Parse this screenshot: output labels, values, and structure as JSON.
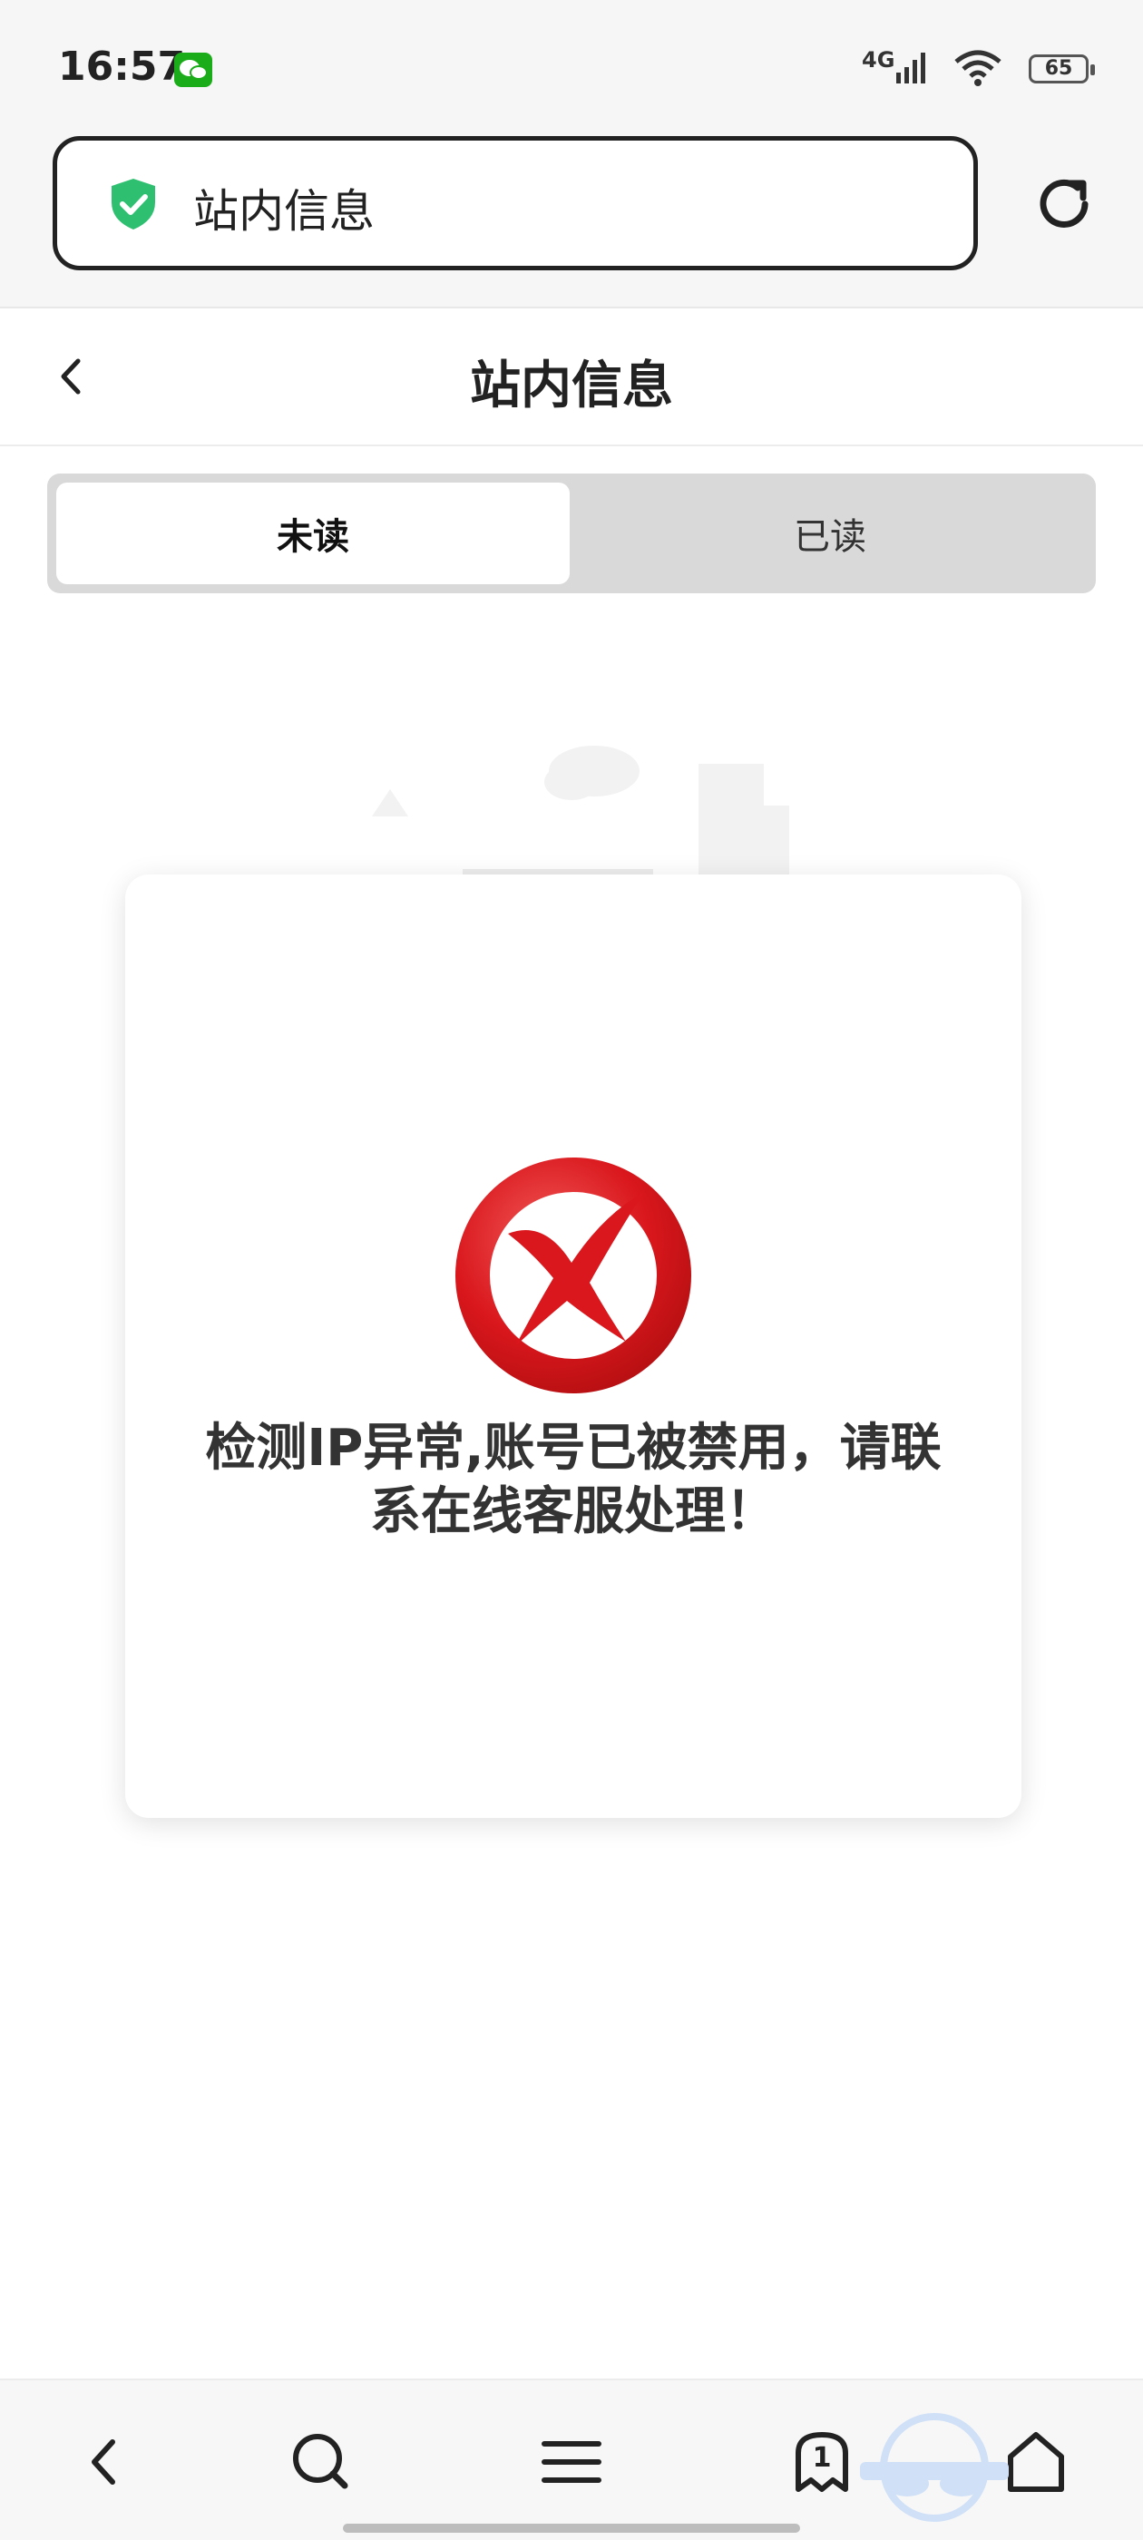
{
  "status_bar": {
    "time": "16:57",
    "network": "4G",
    "battery": "65"
  },
  "address_bar": {
    "url_text": "站内信息",
    "secure_icon": "shield-check-icon",
    "reload_icon": "refresh-icon"
  },
  "page": {
    "title": "站内信息",
    "back_icon": "chevron-left-icon"
  },
  "tabs": [
    {
      "label": "未读",
      "active": true
    },
    {
      "label": "已读",
      "active": false
    }
  ],
  "modal": {
    "icon": "red-x-error-icon",
    "message_line1": "检测IP异常,账号已被禁用，请联",
    "message_line2": "系在线客服处理！"
  },
  "bottom_nav": {
    "items": [
      {
        "name": "back",
        "icon": "chevron-left-icon"
      },
      {
        "name": "search",
        "icon": "search-icon"
      },
      {
        "name": "menu",
        "icon": "menu-icon"
      },
      {
        "name": "tabs",
        "icon": "tabs-icon",
        "count": "1"
      },
      {
        "name": "home",
        "icon": "home-icon"
      }
    ]
  },
  "colors": {
    "accent_green": "#2fbf71",
    "error_red": "#d9171c",
    "tab_bg": "#d9d9d9"
  }
}
